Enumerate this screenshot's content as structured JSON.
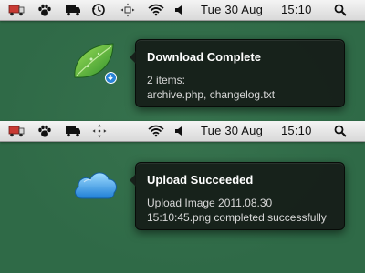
{
  "menubar_1": {
    "icons": [
      "red-truck-icon",
      "paw-icon",
      "truck-icon",
      "time-machine-icon",
      "resize-arrows-icon",
      "wifi-icon",
      "volume-icon",
      "spotlight-search-icon"
    ],
    "date": "Tue 30 Aug",
    "time": "15:10"
  },
  "notification_1": {
    "title": "Download Complete",
    "line1": "2 items:",
    "line2": "archive.php, changelog.txt",
    "app_icon": "leaf-icon",
    "badge_icon": "download-badge-icon"
  },
  "menubar_2": {
    "icons": [
      "red-truck-icon",
      "paw-icon",
      "truck-icon",
      "move-arrows-icon",
      "wifi-icon",
      "volume-icon",
      "spotlight-search-icon"
    ],
    "date": "Tue 30 Aug",
    "time": "15:10"
  },
  "notification_2": {
    "title": "Upload Succeeded",
    "line1": "Upload Image 2011.08.30",
    "line2": "15:10:45.png completed successfully",
    "app_icon": "cloud-icon"
  }
}
